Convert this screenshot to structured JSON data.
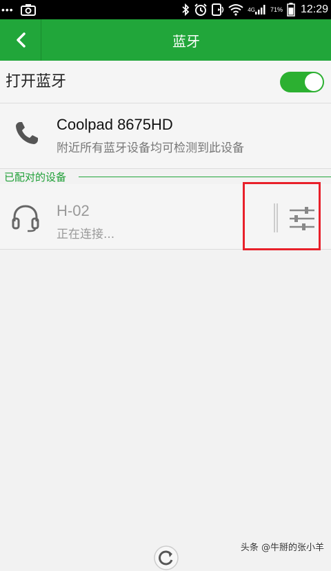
{
  "status_bar": {
    "carrier": "4G",
    "battery_percent": "71%",
    "time": "12:29",
    "icons": [
      "dots-icon",
      "screenshot-icon",
      "bluetooth-icon",
      "alarm-icon",
      "nfc-icon",
      "wifi-icon",
      "signal-icon",
      "battery-icon"
    ]
  },
  "action_bar": {
    "title": "蓝牙",
    "back_icon": "chevron-left-icon"
  },
  "bluetooth_toggle": {
    "label": "打开蓝牙",
    "enabled": true,
    "accent": "#2cb031"
  },
  "this_device": {
    "name": "Coolpad 8675HD",
    "description": "附近所有蓝牙设备均可检测到此设备",
    "icon": "phone-icon"
  },
  "paired_section": {
    "title": "已配对的设备",
    "devices": [
      {
        "name": "H-02",
        "status": "正在连接...",
        "icon": "headset-icon",
        "settings_icon": "settings-sliders-icon"
      }
    ]
  },
  "colors": {
    "brand_green": "#21a63a",
    "highlight_red": "#e8202a"
  },
  "watermark": "头条 @牛掰的张小羊"
}
